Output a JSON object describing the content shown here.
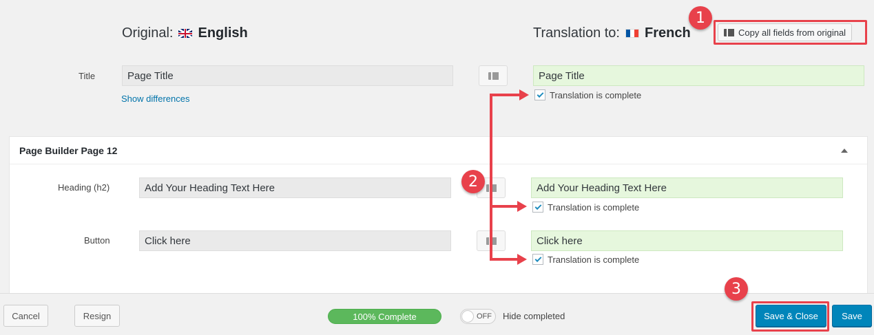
{
  "header": {
    "original_label": "Original:",
    "original_lang": "English",
    "original_flag": "uk-flag-icon",
    "translation_label": "Translation to:",
    "translation_lang": "French",
    "translation_flag": "fr-flag-icon",
    "copy_all_label": "Copy all fields from original"
  },
  "title_row": {
    "label": "Title",
    "original_value": "Page Title",
    "translated_value": "Page Title",
    "show_differences": "Show differences",
    "complete_label": "Translation is complete",
    "complete_checked": true
  },
  "panel": {
    "title": "Page Builder Page 12",
    "rows": [
      {
        "label": "Heading (h2)",
        "original_value": "Add Your Heading Text Here",
        "translated_value": "Add Your Heading Text Here",
        "complete_label": "Translation is complete",
        "complete_checked": true
      },
      {
        "label": "Button",
        "original_value": "Click here",
        "translated_value": "Click here",
        "complete_label": "Translation is complete",
        "complete_checked": true
      }
    ]
  },
  "footer": {
    "cancel_label": "Cancel",
    "resign_label": "Resign",
    "progress_label": "100% Complete",
    "progress_percent": 100,
    "toggle_state": "OFF",
    "hide_completed_label": "Hide completed",
    "save_close_label": "Save & Close",
    "save_label": "Save"
  },
  "annotations": {
    "step1": "1",
    "step2": "2",
    "step3": "3",
    "color": "#e8414b"
  },
  "colors": {
    "primary": "#0085ba",
    "progress": "#5cb85c",
    "translated_bg": "#e6f7dd",
    "link": "#0073aa"
  }
}
